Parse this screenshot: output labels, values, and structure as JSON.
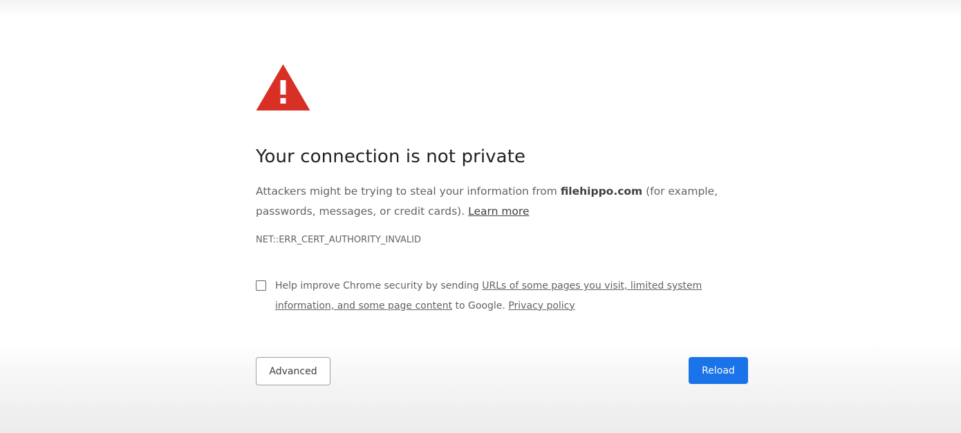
{
  "heading": "Your connection is not private",
  "message": {
    "before_host": "Attackers might be trying to steal your information from ",
    "host": "filehippo.com",
    "after_host": " (for example, passwords, messages, or credit cards). ",
    "learn_more": "Learn more"
  },
  "error_code": "NET::ERR_CERT_AUTHORITY_INVALID",
  "opt_in": {
    "checked": false,
    "before_link": "Help improve Chrome security by sending ",
    "link": "URLs of some pages you visit, limited system information, and some page content",
    "after_link": " to Google. ",
    "privacy_policy": "Privacy policy"
  },
  "buttons": {
    "advanced": "Advanced",
    "reload": "Reload"
  },
  "icons": {
    "warning": "warning-triangle-icon"
  },
  "colors": {
    "warning_red": "#d93025",
    "primary_blue": "#1a73e8",
    "heading_text": "#202124",
    "body_text": "#5f6368"
  }
}
